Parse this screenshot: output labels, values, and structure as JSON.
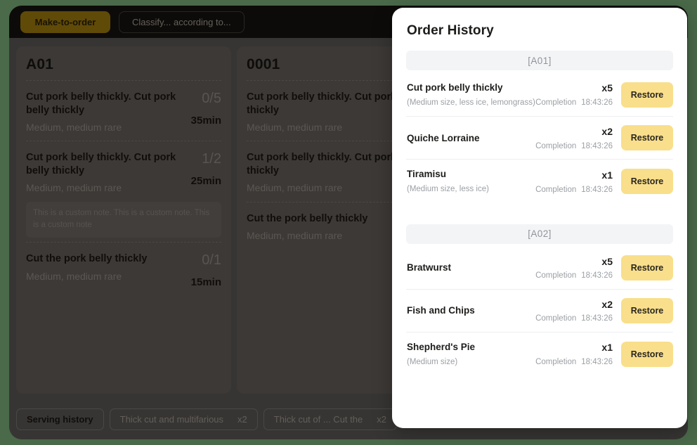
{
  "app": {
    "tabs": [
      {
        "label": "Make-to-order",
        "active": true
      },
      {
        "label": "Classify... according to...",
        "active": false
      }
    ],
    "columns": [
      {
        "title": "A01",
        "lines": [
          {
            "name": "Cut pork belly thickly. Cut pork belly thickly",
            "options": "Medium, medium rare",
            "count": "0/5",
            "time": "35min",
            "note": null
          },
          {
            "name": "Cut pork belly thickly. Cut pork belly thickly",
            "options": "Medium, medium rare",
            "count": "1/2",
            "time": "25min",
            "note": "This is a custom note. This is a custom note. This is a custom note"
          },
          {
            "name": "Cut the pork belly thickly",
            "options": "Medium, medium rare",
            "count": "0/1",
            "time": "15min",
            "note": null
          }
        ]
      },
      {
        "title": "0001",
        "lines": [
          {
            "name": "Cut pork belly thickly. Cut pork belly thickly",
            "options": "Medium, medium rare",
            "count": "",
            "time": "",
            "note": null
          },
          {
            "name": "Cut pork belly thickly. Cut pork belly thickly",
            "options": "Medium, medium rare",
            "count": "",
            "time": "",
            "note": null
          },
          {
            "name": "Cut the pork belly thickly",
            "options": "Medium, medium rare",
            "count": "",
            "time": "",
            "note": null
          }
        ]
      }
    ],
    "bottom_bar": {
      "serving_history_label": "Serving history",
      "chips": [
        {
          "label": "Thick cut and multifarious",
          "qty": "x2"
        },
        {
          "label": "Thick cut of ... Cut the",
          "qty": "x2"
        }
      ]
    }
  },
  "drawer": {
    "title": "Order History",
    "restore_label": "Restore",
    "completion_label": "Completion",
    "sections": [
      {
        "header": "[A01]",
        "rows": [
          {
            "name": "Cut pork belly thickly",
            "options": "(Medium size, less ice, lemongrass)",
            "qty": "x5",
            "completion_label": "Completion",
            "time": "18:43:26",
            "restore_label": "Restore"
          },
          {
            "name": "Quiche Lorraine",
            "options": "",
            "qty": "x2",
            "completion_label": "Completion",
            "time": "18:43:26",
            "restore_label": "Restore"
          },
          {
            "name": "Tiramisu",
            "options": "(Medium size, less ice)",
            "qty": "x1",
            "completion_label": "Completion",
            "time": "18:43:26",
            "restore_label": "Restore"
          }
        ]
      },
      {
        "header": "[A02]",
        "rows": [
          {
            "name": "Bratwurst",
            "options": "",
            "qty": "x5",
            "completion_label": "Completion",
            "time": "18:43:26",
            "restore_label": "Restore"
          },
          {
            "name": "Fish and Chips",
            "options": "",
            "qty": "x2",
            "completion_label": "Completion",
            "time": "18:43:26",
            "restore_label": "Restore"
          },
          {
            "name": "Shepherd's Pie",
            "options": "(Medium size)",
            "qty": "x1",
            "completion_label": "Completion",
            "time": "18:43:26",
            "restore_label": "Restore"
          }
        ]
      }
    ]
  },
  "colors": {
    "accent_yellow": "#f9df8b",
    "tab_active": "#8a6a0c",
    "card_bg": "#56524e",
    "app_bg": "#504c49",
    "drawer_bg": "#ffffff",
    "section_pill": "#f3f4f6"
  }
}
